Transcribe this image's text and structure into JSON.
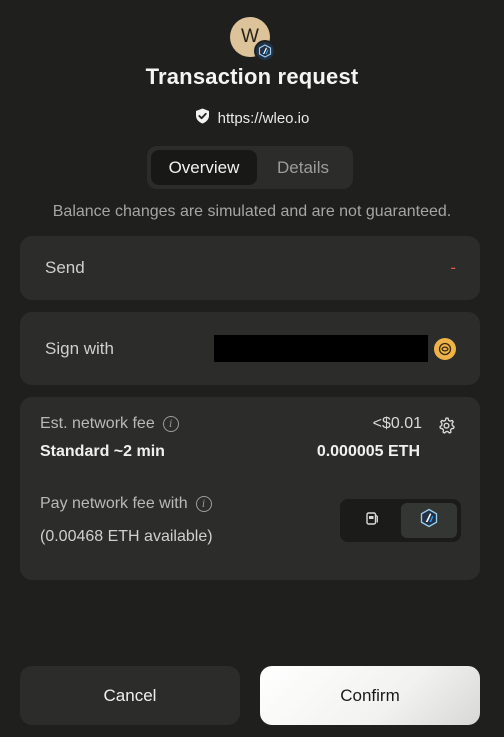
{
  "header": {
    "avatar_letter": "W",
    "chain_icon": "arbitrum-icon",
    "title": "Transaction request",
    "origin_icon": "verified-shield-icon",
    "origin_url": "https://wleo.io"
  },
  "tabs": [
    {
      "label": "Overview",
      "active": true
    },
    {
      "label": "Details",
      "active": false
    }
  ],
  "notice": "Balance changes are simulated and are not guaranteed.",
  "send": {
    "label": "Send",
    "value": "-"
  },
  "sign_with": {
    "label": "Sign with",
    "account_icon": "wallet-account-icon"
  },
  "fee": {
    "label": "Est. network fee",
    "usd": "<$0.01",
    "speed": "Standard ~2 min",
    "eth": "0.000005 ETH",
    "pay_label": "Pay network fee with",
    "available": "(0.00468 ETH available)",
    "options": [
      {
        "icon": "gas-station-icon",
        "active": false
      },
      {
        "icon": "arbitrum-icon",
        "active": true
      }
    ]
  },
  "actions": {
    "cancel": "Cancel",
    "confirm": "Confirm"
  },
  "colors": {
    "background": "#1f201e",
    "card": "#2c2d2b",
    "negative": "#e5534b",
    "arbitrum": "#213147"
  }
}
